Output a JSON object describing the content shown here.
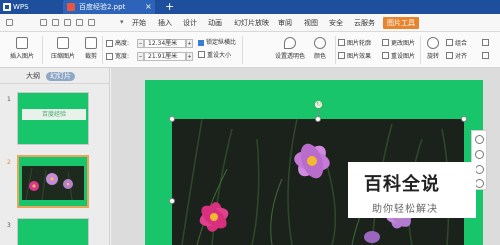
{
  "titlebar": {
    "app_name": "WPS",
    "doc_tab": "百度经验2.ppt",
    "close_glyph": "×",
    "new_tab_glyph": "+"
  },
  "ribbon": {
    "tabs": [
      "开始",
      "插入",
      "设计",
      "动画",
      "幻灯片放映",
      "审阅",
      "视图",
      "安全",
      "云服务",
      "图片工具"
    ],
    "active_tab": "图片工具"
  },
  "toolbar": {
    "insert_picture": "插入图片",
    "compress_picture": "压缩图片",
    "crop": "裁剪",
    "height_label": "高度:",
    "height_value": "12.34厘米",
    "width_label": "宽度:",
    "width_value": "21.91厘米",
    "lock_ratio": "锁定纵横比",
    "reset_size": "重设大小",
    "set_transparent": "设置透明色",
    "color": "颜色",
    "picture_outline": "图片轮廓",
    "picture_effect": "图片效果",
    "change_picture": "更改图片",
    "reset_picture": "重设图片",
    "rotate": "旋转",
    "combine": "组合",
    "align": "对齐"
  },
  "left_pane": {
    "tab_outline": "大纲",
    "tab_slides": "幻灯片",
    "slides": [
      {
        "num": "1",
        "title": "百度经验"
      },
      {
        "num": "2"
      },
      {
        "num": "3"
      }
    ]
  },
  "watermark": {
    "title": "百科全说",
    "subtitle": "助你轻松解决"
  },
  "colors": {
    "titlebar": "#1e4f9d",
    "accent": "#e7852f",
    "slide_bg": "#19c56b"
  }
}
